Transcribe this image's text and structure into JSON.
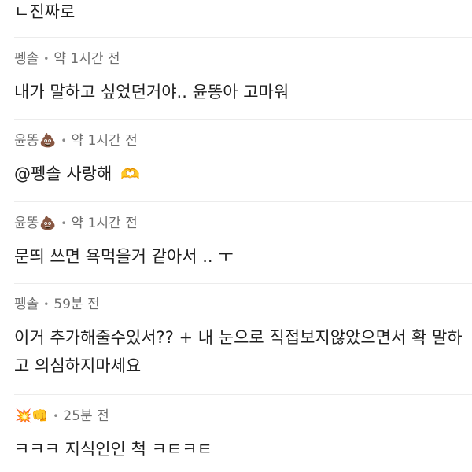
{
  "comments": [
    {
      "author": "",
      "author_emoji": "",
      "time": "",
      "text": "ㄴ진짜로"
    },
    {
      "author": "펭솔",
      "author_emoji": "",
      "time": "약 1시간 전",
      "text": "내가 말하고 싶었던거야.. 윤똥아 고마워"
    },
    {
      "author": "윤똥",
      "author_emoji": "💩",
      "time": "약 1시간 전",
      "text": "@펭솔 사랑해",
      "trailing_emoji": "🫶"
    },
    {
      "author": "윤똥",
      "author_emoji": "💩",
      "time": "약 1시간 전",
      "text": "문띄 쓰면 욕먹을거 같아서 .. ㅜ"
    },
    {
      "author": "펭솔",
      "author_emoji": "",
      "time": "59분 전",
      "text": "이거 추가해줄수있서?? + 내 눈으로 직접보지않았으면서 확 말하고 의심하지마세요"
    },
    {
      "author": "",
      "author_emoji": "💥👊",
      "time": "25분 전",
      "text": "ㅋㅋㅋ 지식인인 척 ㅋㅌㅋㅌ"
    }
  ],
  "separator": "•"
}
